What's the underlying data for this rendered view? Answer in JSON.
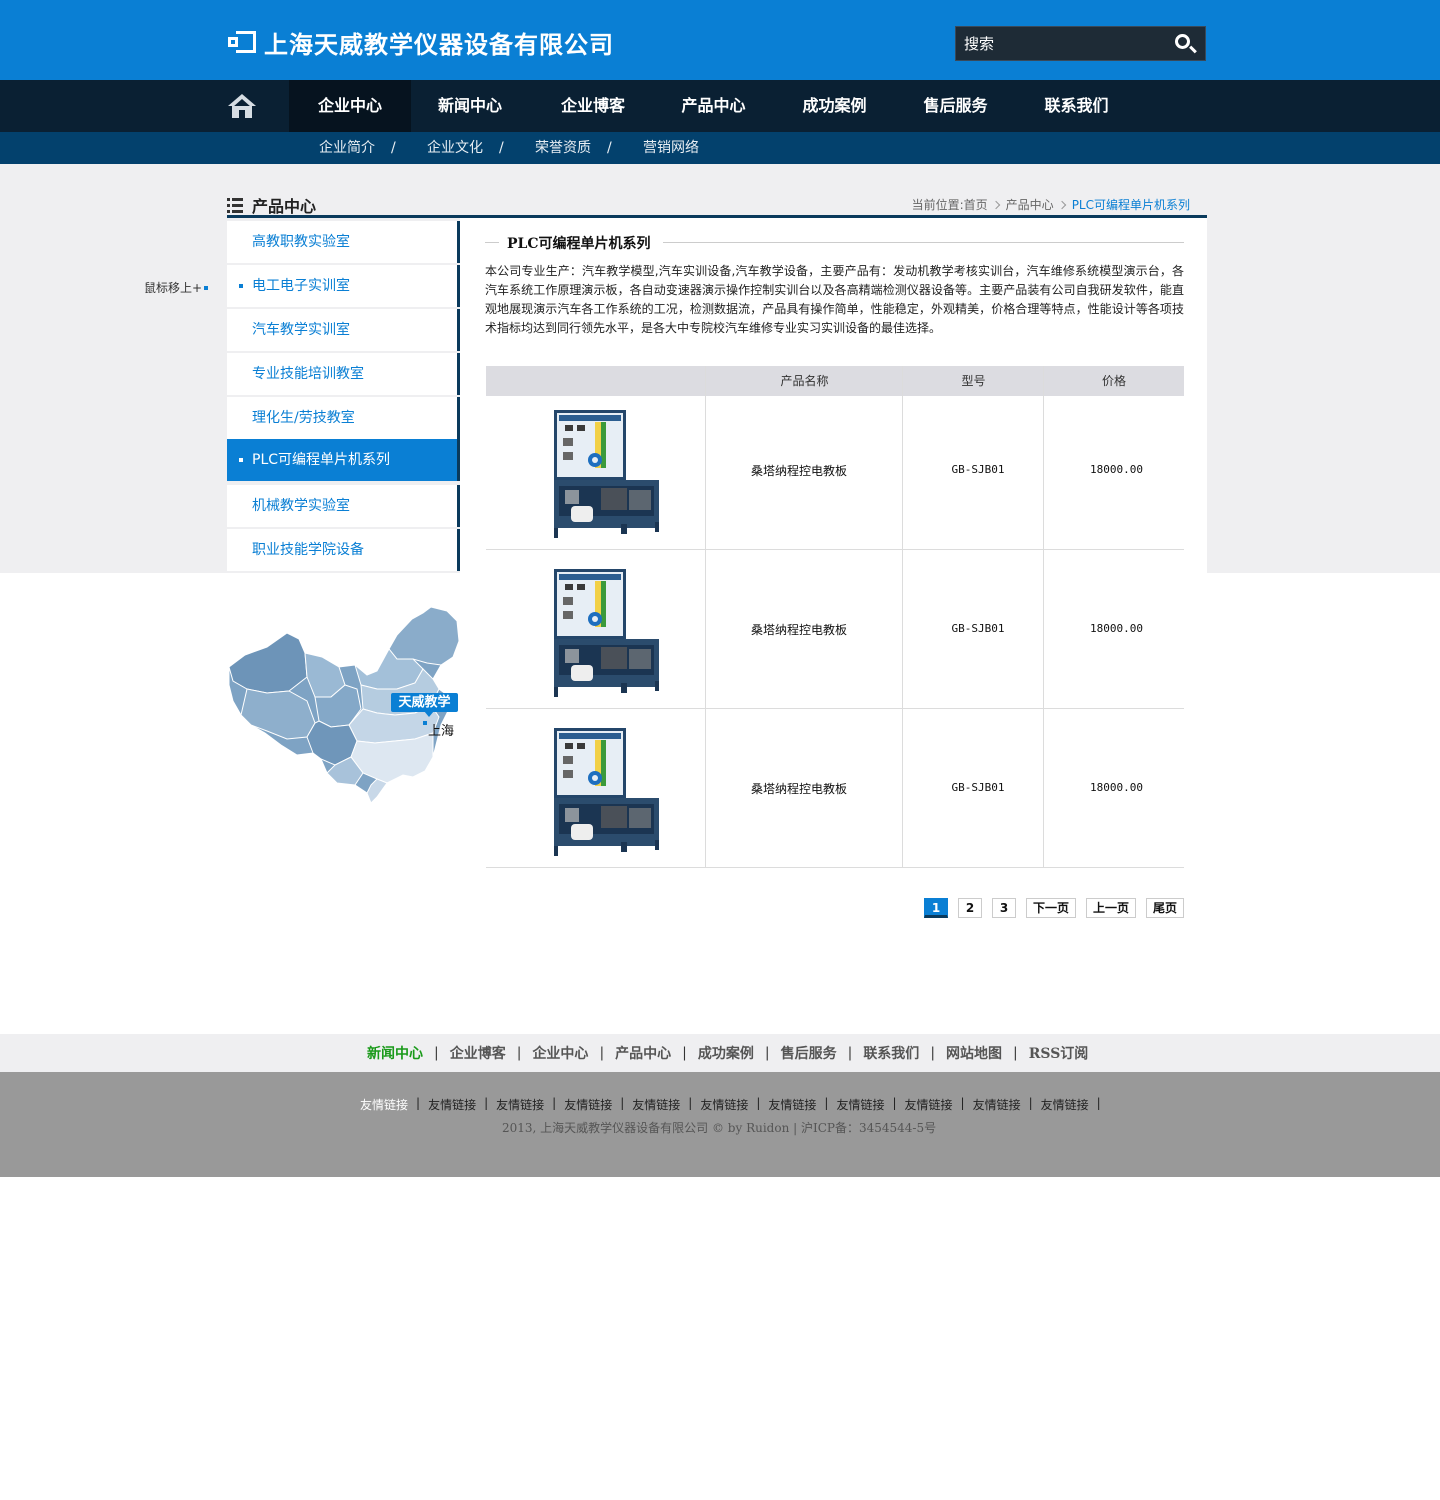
{
  "header": {
    "company_name": "上海天威教学仪器设备有限公司",
    "search_placeholder": "搜索"
  },
  "nav": {
    "items": [
      "企业中心",
      "新闻中心",
      "企业博客",
      "产品中心",
      "成功案例",
      "售后服务",
      "联系我们"
    ],
    "active": "企业中心"
  },
  "subnav": {
    "items": [
      "企业简介",
      "企业文化",
      "荣誉资质",
      "营销网络"
    ],
    "separator": "/"
  },
  "section": {
    "title": "产品中心",
    "hover_tip": "鼠标移上+"
  },
  "breadcrumb": {
    "prefix": "当前位置:",
    "items": [
      "首页",
      "产品中心",
      "PLC可编程单片机系列"
    ]
  },
  "sidebar": {
    "items": [
      {
        "label": "高教职教实验室",
        "dot": false,
        "active": false
      },
      {
        "label": "电工电子实训室",
        "dot": true,
        "active": false
      },
      {
        "label": "汽车教学实训室",
        "dot": false,
        "active": false
      },
      {
        "label": "专业技能培训教室",
        "dot": false,
        "active": false
      },
      {
        "label": "理化生/劳技教室",
        "dot": false,
        "active": false
      },
      {
        "label": "PLC可编程单片机系列",
        "dot": true,
        "active": true
      },
      {
        "label": "机械教学实验室",
        "dot": false,
        "active": false
      },
      {
        "label": "职业技能学院设备",
        "dot": false,
        "active": false
      }
    ]
  },
  "map": {
    "tag": "天威教学",
    "city": "上海"
  },
  "content": {
    "title": "PLC可编程单片机系列",
    "description": "本公司专业生产：汽车教学模型,汽车实训设备,汽车教学设备，主要产品有：发动机教学考核实训台，汽车维修系统模型演示台，各汽车系统工作原理演示板，各自动变速器演示操作控制实训台以及各高精端检测仪器设备等。主要产品装有公司自我研发软件，能直观地展现演示汽车各工作系统的工况，检测数据流，产品具有操作简单，性能稳定，外观精美，价格合理等特点，性能设计等各项技术指标均达到同行领先水平，是各大中专院校汽车维修专业实习实训设备的最佳选择。"
  },
  "table": {
    "headers": [
      "",
      "产品名称",
      "型号",
      "价格"
    ],
    "rows": [
      {
        "name": "桑塔纳程控电教板",
        "model": "GB-SJB01",
        "price": "18000.00"
      },
      {
        "name": "桑塔纳程控电教板",
        "model": "GB-SJB01",
        "price": "18000.00"
      },
      {
        "name": "桑塔纳程控电教板",
        "model": "GB-SJB01",
        "price": "18000.00"
      }
    ]
  },
  "pagination": {
    "pages": [
      "1",
      "2",
      "3"
    ],
    "current": "1",
    "next": "下一页",
    "prev": "上一页",
    "last": "尾页"
  },
  "footer": {
    "nav": [
      "新闻中心",
      "企业博客",
      "企业中心",
      "产品中心",
      "成功案例",
      "售后服务",
      "联系我们",
      "网站地图",
      "RSS订阅"
    ],
    "nav_separator": "|",
    "links": [
      "友情链接",
      "友情链接",
      "友情链接",
      "友情链接",
      "友情链接",
      "友情链接",
      "友情链接",
      "友情链接",
      "友情链接",
      "友情链接",
      "友情链接"
    ],
    "link_separator": "|",
    "copyright": "2013, 上海天威教学仪器设备有限公司 © by Ruidon | 沪ICP备：3454544-5号"
  },
  "colors": {
    "brand_blue": "#0a7fd4",
    "nav_dark": "#0a2033",
    "subnav_blue": "#03416d",
    "footer_green": "#1a9a1a"
  }
}
